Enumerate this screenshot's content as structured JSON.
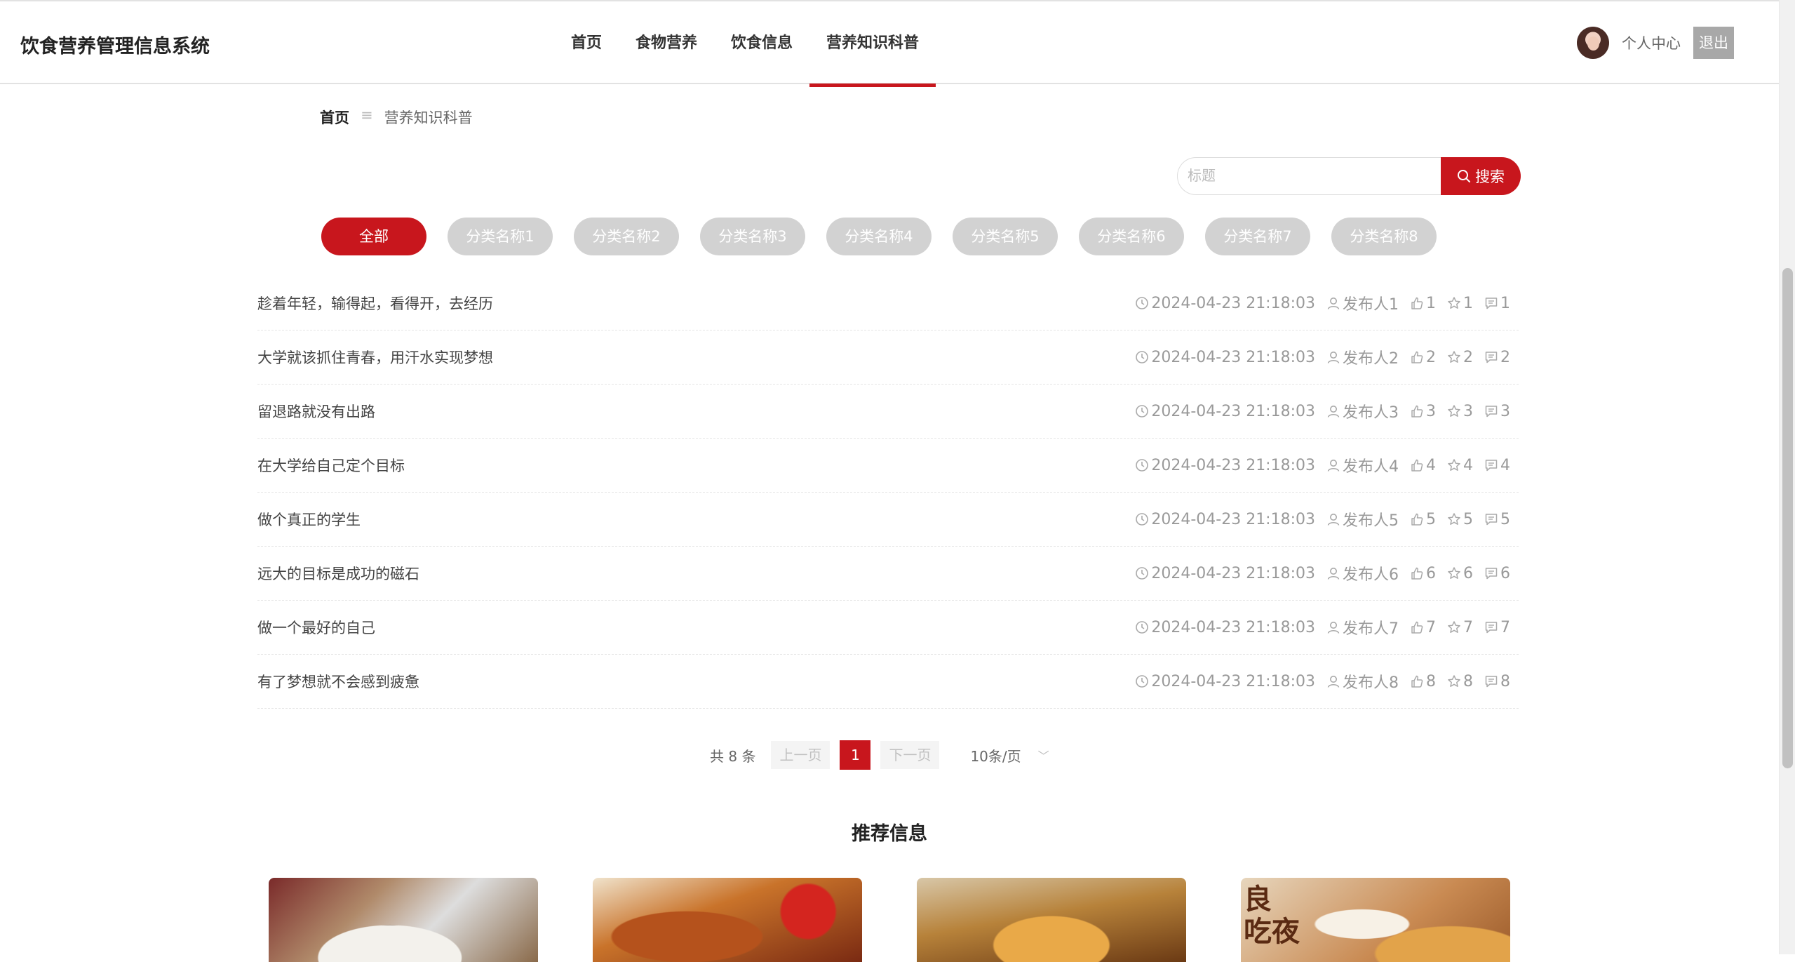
{
  "header": {
    "brand": "饮食营养管理信息系统",
    "nav": [
      "首页",
      "食物营养",
      "饮食信息",
      "营养知识科普"
    ],
    "active_nav": 3,
    "user_center": "个人中心",
    "logout": "退出"
  },
  "breadcrumb": {
    "home": "首页",
    "separator": "≡",
    "current": "营养知识科普"
  },
  "search": {
    "placeholder": "标题",
    "value": "",
    "button": "搜索"
  },
  "categories": [
    "全部",
    "分类名称1",
    "分类名称2",
    "分类名称3",
    "分类名称4",
    "分类名称5",
    "分类名称6",
    "分类名称7",
    "分类名称8"
  ],
  "active_category": 0,
  "articles": [
    {
      "title": "趁着年轻，输得起，看得开，去经历",
      "time": "2024-04-23 21:18:03",
      "author": "发布人1",
      "likes": "1",
      "favorites": "1",
      "comments": "1"
    },
    {
      "title": "大学就该抓住青春，用汗水实现梦想",
      "time": "2024-04-23 21:18:03",
      "author": "发布人2",
      "likes": "2",
      "favorites": "2",
      "comments": "2"
    },
    {
      "title": "留退路就没有出路",
      "time": "2024-04-23 21:18:03",
      "author": "发布人3",
      "likes": "3",
      "favorites": "3",
      "comments": "3"
    },
    {
      "title": "在大学给自己定个目标",
      "time": "2024-04-23 21:18:03",
      "author": "发布人4",
      "likes": "4",
      "favorites": "4",
      "comments": "4"
    },
    {
      "title": "做个真正的学生",
      "time": "2024-04-23 21:18:03",
      "author": "发布人5",
      "likes": "5",
      "favorites": "5",
      "comments": "5"
    },
    {
      "title": "远大的目标是成功的磁石",
      "time": "2024-04-23 21:18:03",
      "author": "发布人6",
      "likes": "6",
      "favorites": "6",
      "comments": "6"
    },
    {
      "title": "做一个最好的自己",
      "time": "2024-04-23 21:18:03",
      "author": "发布人7",
      "likes": "7",
      "favorites": "7",
      "comments": "7"
    },
    {
      "title": "有了梦想就不会感到疲惫",
      "time": "2024-04-23 21:18:03",
      "author": "发布人8",
      "likes": "8",
      "favorites": "8",
      "comments": "8"
    }
  ],
  "pagination": {
    "total": "共 8 条",
    "prev": "上一页",
    "current": "1",
    "next": "下一页",
    "page_size": "10条/页"
  },
  "recommend": {
    "title": "推荐信息",
    "card4_text": "良\n吃夜"
  },
  "colors": {
    "accent": "#c8161d",
    "pill_inactive": "#d2d2d2",
    "meta_text": "#999999"
  },
  "icons": {
    "time": "clock-icon",
    "author": "user-icon",
    "likes": "thumb-up-icon",
    "favorites": "star-icon",
    "comments": "comment-icon",
    "search": "search-icon"
  }
}
